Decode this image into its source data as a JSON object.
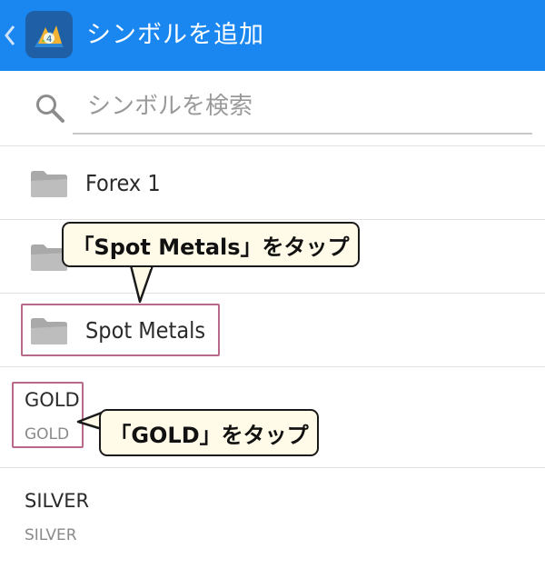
{
  "header": {
    "title": "シンボルを追加",
    "back_icon": "chevron-left-icon",
    "app_icon": "metatrader-app-icon",
    "bg_color": "#1a86f0"
  },
  "search": {
    "placeholder": "シンボルを検索",
    "icon": "search-icon"
  },
  "folders": [
    {
      "label": "Forex 1",
      "icon": "folder-icon"
    },
    {
      "label": "",
      "icon": "folder-icon"
    },
    {
      "label": "Spot Metals",
      "icon": "folder-icon"
    }
  ],
  "symbols": [
    {
      "name": "GOLD",
      "description": "GOLD"
    },
    {
      "name": "SILVER",
      "description": "SILVER"
    }
  ],
  "annotations": {
    "spot_metals_callout": "「Spot Metals」をタップ",
    "gold_callout": "「GOLD」をタップ",
    "highlight_color": "#b86a8a",
    "callout_bg": "#fffbe8"
  }
}
